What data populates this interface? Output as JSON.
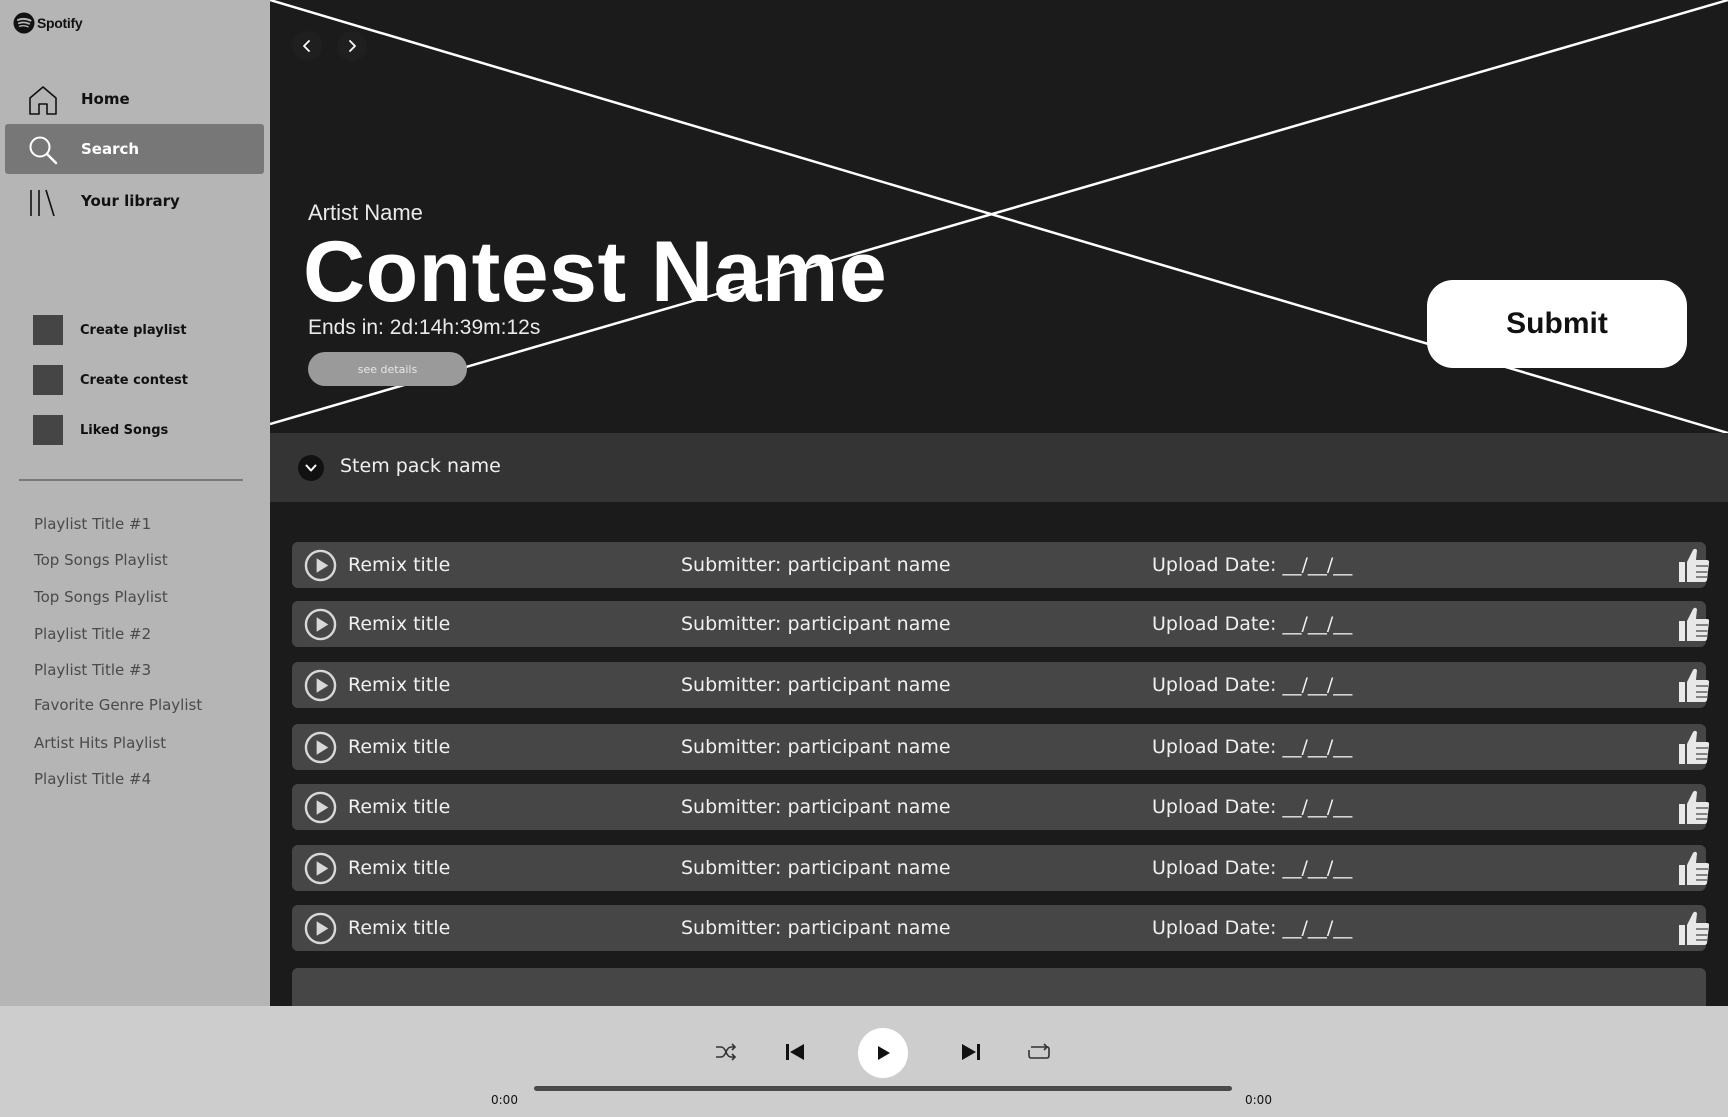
{
  "app": {
    "brand": "Spotify"
  },
  "sidebar": {
    "nav": [
      {
        "label": "Home",
        "icon": "home-icon"
      },
      {
        "label": "Search",
        "icon": "search-icon",
        "active": true
      },
      {
        "label": "Your library",
        "icon": "library-icon"
      }
    ],
    "actions": [
      {
        "label": "Create playlist"
      },
      {
        "label": "Create contest"
      },
      {
        "label": "Liked Songs"
      }
    ],
    "playlists": [
      "Playlist Title #1",
      "Top Songs Playlist",
      "Top Songs Playlist",
      "Playlist Title #2",
      "Playlist Title #3",
      "Favorite Genre Playlist",
      "Artist Hits Playlist",
      "Playlist Title #4"
    ]
  },
  "hero": {
    "artist": "Artist Name",
    "contest_name": "Contest Name",
    "ends": "Ends in: 2d:14h:39m:12s",
    "details_label": "see details",
    "submit_label": "Submit"
  },
  "stem": {
    "label": "Stem pack name"
  },
  "remixes": [
    {
      "title": "Remix title",
      "submitter": "Submitter: participant name",
      "date": "Upload Date: __/__/__"
    },
    {
      "title": "Remix title",
      "submitter": "Submitter: participant name",
      "date": "Upload Date: __/__/__"
    },
    {
      "title": "Remix title",
      "submitter": "Submitter: participant name",
      "date": "Upload Date: __/__/__"
    },
    {
      "title": "Remix title",
      "submitter": "Submitter: participant name",
      "date": "Upload Date: __/__/__"
    },
    {
      "title": "Remix title",
      "submitter": "Submitter: participant name",
      "date": "Upload Date: __/__/__"
    },
    {
      "title": "Remix title",
      "submitter": "Submitter: participant name",
      "date": "Upload Date: __/__/__"
    },
    {
      "title": "Remix title",
      "submitter": "Submitter: participant name",
      "date": "Upload Date: __/__/__"
    }
  ],
  "player": {
    "elapsed": "0:00",
    "duration": "0:00",
    "progress": 0,
    "controls": [
      "shuffle-icon",
      "previous-icon",
      "play-icon",
      "next-icon",
      "repeat-icon"
    ]
  },
  "colors": {
    "sidebar_bg": "#b5b5b5",
    "active_nav": "#777777",
    "main_bg": "#1b1b1b",
    "row_bg": "#464646",
    "player_bg": "#cdcdcd"
  }
}
